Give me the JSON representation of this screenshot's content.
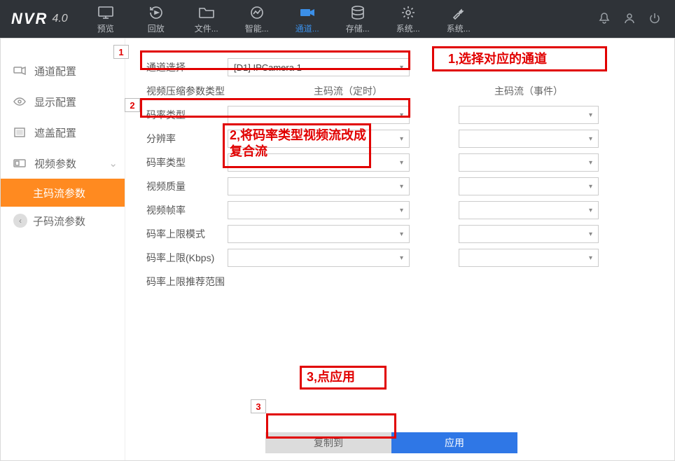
{
  "logo": {
    "title": "NVR",
    "version": "4.0"
  },
  "topnav": [
    {
      "label": "预览"
    },
    {
      "label": "回放"
    },
    {
      "label": "文件..."
    },
    {
      "label": "智能..."
    },
    {
      "label": "通道..."
    },
    {
      "label": "存储..."
    },
    {
      "label": "系统..."
    },
    {
      "label": "系统..."
    }
  ],
  "sidebar": {
    "items": [
      {
        "label": "通道配置"
      },
      {
        "label": "显示配置"
      },
      {
        "label": "遮盖配置"
      },
      {
        "label": "视频参数"
      }
    ],
    "subs": [
      {
        "label": "主码流参数"
      },
      {
        "label": "子码流参数"
      }
    ]
  },
  "form": {
    "channel_label": "通道选择",
    "channel_value": "[D1] IPCamera 1",
    "compress_label": "视频压缩参数类型",
    "col1_header": "主码流（定时）",
    "col2_header": "主码流（事件）",
    "stream_type_label": "码率类型",
    "resolution_label": "分辨率",
    "bitrate_type_label": "码率类型",
    "quality_label": "视频质量",
    "framerate_label": "视频帧率",
    "bitrate_mode_label": "码率上限模式",
    "bitrate_kbps_label": "码率上限(Kbps)",
    "bitrate_range_label": "码率上限推荐范围"
  },
  "buttons": {
    "copy": "复制到",
    "apply": "应用"
  },
  "annotations": {
    "n1": "1",
    "n2": "2",
    "n3": "3",
    "t1": "1,选择对应的通道",
    "t2": "2,将码率类型视频流改成复合流",
    "t3": "3,点应用"
  }
}
